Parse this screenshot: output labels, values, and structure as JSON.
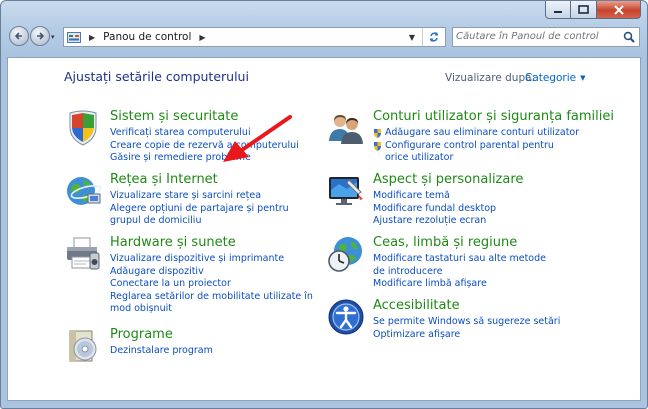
{
  "address": {
    "crumb": "Panou de control",
    "search_placeholder": "Căutare în Panoul de control"
  },
  "header": {
    "title": "Ajustați setările computerului",
    "view_by_label": "Vizualizare după:",
    "view_by_value": "Categorie"
  },
  "categories": {
    "system": {
      "title": "Sistem și securitate",
      "links": [
        "Verificați starea computerului",
        "Creare copie de rezervă a computerului",
        "Găsire și remediere probleme"
      ]
    },
    "network": {
      "title": "Rețea și Internet",
      "links": [
        "Vizualizare stare și sarcini rețea",
        "Alegere opțiuni de partajare și pentru grupul de domiciliu"
      ]
    },
    "hardware": {
      "title": "Hardware și sunete",
      "links": [
        "Vizualizare dispozitive și imprimante",
        "Adăugare dispozitiv",
        "Conectare la un proiector",
        "Reglarea setărilor de mobilitate utilizate în mod obișnuit"
      ]
    },
    "programs": {
      "title": "Programe",
      "links": [
        "Dezinstalare program"
      ]
    },
    "users": {
      "title": "Conturi utilizator și siguranța familiei",
      "links": [
        "Adăugare sau eliminare conturi utilizator",
        "Configurare control parental pentru orice utilizator"
      ]
    },
    "appearance": {
      "title": "Aspect și personalizare",
      "links": [
        "Modificare temă",
        "Modificare fundal desktop",
        "Ajustare rezoluție ecran"
      ]
    },
    "clock": {
      "title": "Ceas, limbă și regiune",
      "links": [
        "Modificare tastaturi sau alte metode de introducere",
        "Modificare limbă afișare"
      ]
    },
    "access": {
      "title": "Accesibilitate",
      "links": [
        "Se permite Windows să sugereze setări",
        "Optimizare afișare"
      ]
    }
  }
}
